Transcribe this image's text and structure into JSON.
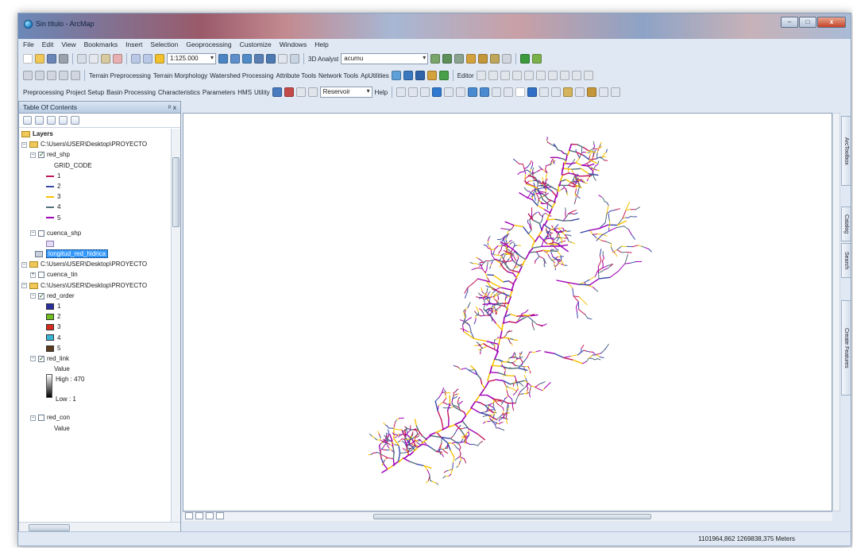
{
  "window": {
    "title": "Sin título - ArcMap"
  },
  "window_controls": {
    "minimize": "–",
    "maximize": "□",
    "close": "x"
  },
  "menubar": [
    "File",
    "Edit",
    "View",
    "Bookmarks",
    "Insert",
    "Selection",
    "Geoprocessing",
    "Customize",
    "Windows",
    "Help"
  ],
  "toolbar1": {
    "scale": "1:125.000",
    "analyst": "3D Analyst",
    "layer": "acumu"
  },
  "toolbar2": {
    "items": [
      "Terrain Preprocessing",
      "Terrain Morphology",
      "Watershed Processing",
      "Attribute Tools",
      "Network Tools",
      "ApUtilities"
    ],
    "editor": "Editor"
  },
  "toolbar3": {
    "items": [
      "Preprocessing",
      "Project Setup",
      "Basin Processing",
      "Characteristics",
      "Parameters",
      "HMS",
      "Utility"
    ],
    "combo": "Reservoir",
    "help": "Help"
  },
  "toc": {
    "title": "Table Of Contents",
    "title_controls": "ᵖ x",
    "layers_label": "Layers",
    "group1_path": "C:\\Users\\USER\\Desktop\\PROYECTO",
    "red_shp": "red_shp",
    "grid_code": "GRID_CODE",
    "legend": [
      {
        "label": "1",
        "color": "#c2185b"
      },
      {
        "label": "2",
        "color": "#3949ab"
      },
      {
        "label": "3",
        "color": "#f5c100"
      },
      {
        "label": "4",
        "color": "#546e7a"
      },
      {
        "label": "5",
        "color": "#a000b8"
      }
    ],
    "cuenca_shp": "cuenca_shp",
    "longitud": "longitud_red_hidrica",
    "group2_path": "C:\\Users\\USER\\Desktop\\PROYECTO",
    "cuenca_tin": "cuenca_tin",
    "group3_path": "C:\\Users\\USER\\Desktop\\PROYECTO",
    "red_order": "red_order",
    "order_legend": [
      {
        "label": "1",
        "color": "#2a2fa0"
      },
      {
        "label": "2",
        "color": "#6fbf1f"
      },
      {
        "label": "3",
        "color": "#d62a1e"
      },
      {
        "label": "4",
        "color": "#37b6d6"
      },
      {
        "label": "5",
        "color": "#5c3b1e"
      }
    ],
    "red_link": "red_link",
    "value_label": "Value",
    "high": "High : 470",
    "low": "Low : 1",
    "red_con": "red_con",
    "value_label2": "Value"
  },
  "dock_tabs": [
    "ArcToolbox",
    "Catalog",
    "Search",
    "Create Features"
  ],
  "status": {
    "coords": "1101964,862  1269838,375 Meters"
  }
}
